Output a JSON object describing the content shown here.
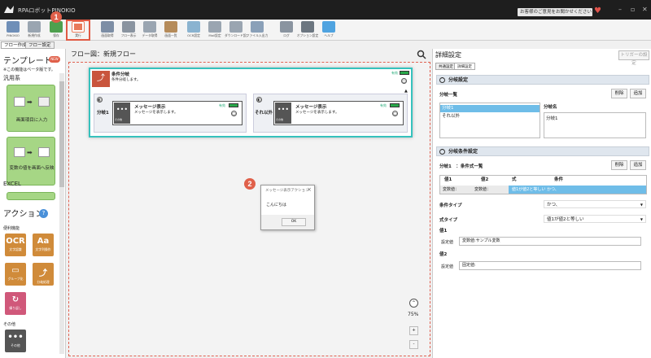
{
  "app": {
    "title": "RPAロボットPINOKIO",
    "feedback": "お客様のご意見をお聞かせください"
  },
  "ribbon": {
    "buttons": [
      {
        "label": "PINOKIO",
        "color": "#6f8fb8"
      },
      {
        "label": "新規作成",
        "color": "#9aa5b1"
      },
      {
        "label": "保存",
        "color": "#4ea04e"
      },
      {
        "label": "実行",
        "color": "#e97a5a"
      },
      {
        "label": "画面取得",
        "color": "#7d8ea5"
      },
      {
        "label": "フロー表示",
        "color": "#8a94a0"
      },
      {
        "label": "データ取得",
        "color": "#9aa5b1"
      },
      {
        "label": "画面一覧",
        "color": "#b58b5a"
      },
      {
        "label": "OCR設定",
        "color": "#8ab3d0"
      },
      {
        "label": "Mail設定",
        "color": "#9aa5b1"
      },
      {
        "label": "ダウンロード設定",
        "color": "#9aa5b1"
      },
      {
        "label": "ファイル入出力",
        "color": "#8aa0b8"
      },
      {
        "label": "ログ",
        "color": "#8a94a0"
      },
      {
        "label": "オプション設定",
        "color": "#6c7680"
      },
      {
        "label": "ヘルプ",
        "color": "#4fa3e0"
      }
    ]
  },
  "markers": {
    "one": "1",
    "two": "2"
  },
  "tabs": {
    "flow_edit": "フロー作成",
    "flow_settings": "フロー設定"
  },
  "sidebar": {
    "template_title": "テンプレート",
    "new_badge": "NEW",
    "beta_note": "※この機能はベータ版です。",
    "category_general": "汎用系",
    "templates": [
      {
        "name": "画面項目に入力"
      },
      {
        "name": "変数の値を画面へ反映"
      }
    ],
    "category_excel": "EXCEL",
    "action_title": "アクション",
    "help_mark": "?",
    "category_common": "便利機能",
    "category_other": "その他",
    "actions": [
      {
        "name": "文字認識",
        "glyph": "OCR",
        "color": "#d08b3a"
      },
      {
        "name": "文字列操作",
        "glyph": "Aa",
        "color": "#d08b3a"
      },
      {
        "name": "グループ化",
        "glyph": "▭",
        "color": "#d08b3a"
      },
      {
        "name": "分岐処理",
        "glyph": "⤴",
        "color": "#d08b3a"
      },
      {
        "name": "繰り返し",
        "glyph": "↻",
        "color": "#d0587a"
      },
      {
        "name": "その他",
        "glyph": "•••",
        "color": "#555555"
      }
    ]
  },
  "canvas": {
    "header": "フロー図：新規フロー",
    "cond": {
      "title": "条件分岐",
      "desc": "条件分岐します。",
      "enable": "有効",
      "branches": [
        {
          "label": "分岐1",
          "msg_title": "メッセージ表示",
          "msg_desc": "メッセージを表示します。",
          "enable": "有効",
          "icon_label": "その他"
        },
        {
          "label": "それ以外",
          "msg_title": "メッセージ表示",
          "msg_desc": "メッセージを表示します。",
          "enable": "有効",
          "icon_label": "その他"
        }
      ]
    },
    "zoom": "75%",
    "zoom_in": "+",
    "zoom_out": "-"
  },
  "dialog": {
    "title": "メッセージ表示アクション",
    "close": "×",
    "message": "こんにちは",
    "ok": "OK"
  },
  "panel": {
    "title": "詳細設定",
    "trigger_btn": "トリガーの設定",
    "tab_common": "共通設定",
    "tab_detail": "詳細設定",
    "branch_section": "分岐設定",
    "branch_list_label": "分岐一覧",
    "delete": "削除",
    "add": "追加",
    "branch_name_label": "分岐名",
    "branch_items": [
      "分岐1",
      "それ以外"
    ],
    "branch_name_value": "分岐1",
    "cond_section": "分岐条件設定",
    "cond_list_label": "分岐1　：条件式一覧",
    "table_headers": [
      "値1",
      "値2",
      "式",
      "条件"
    ],
    "table_row": [
      "変数値：",
      "変数値：",
      "値1が値2と等しい かつ、"
    ],
    "cond_type_label": "条件タイプ",
    "cond_type_value": "かつ、",
    "expr_type_label": "式タイプ",
    "expr_type_value": "値1が値2と等しい",
    "value1_label": "値1",
    "value1_field": "設定値",
    "value1_value": "変数値:サンプル変数",
    "value2_label": "値2",
    "value2_field": "設定値",
    "value2_value": "固定値:"
  }
}
